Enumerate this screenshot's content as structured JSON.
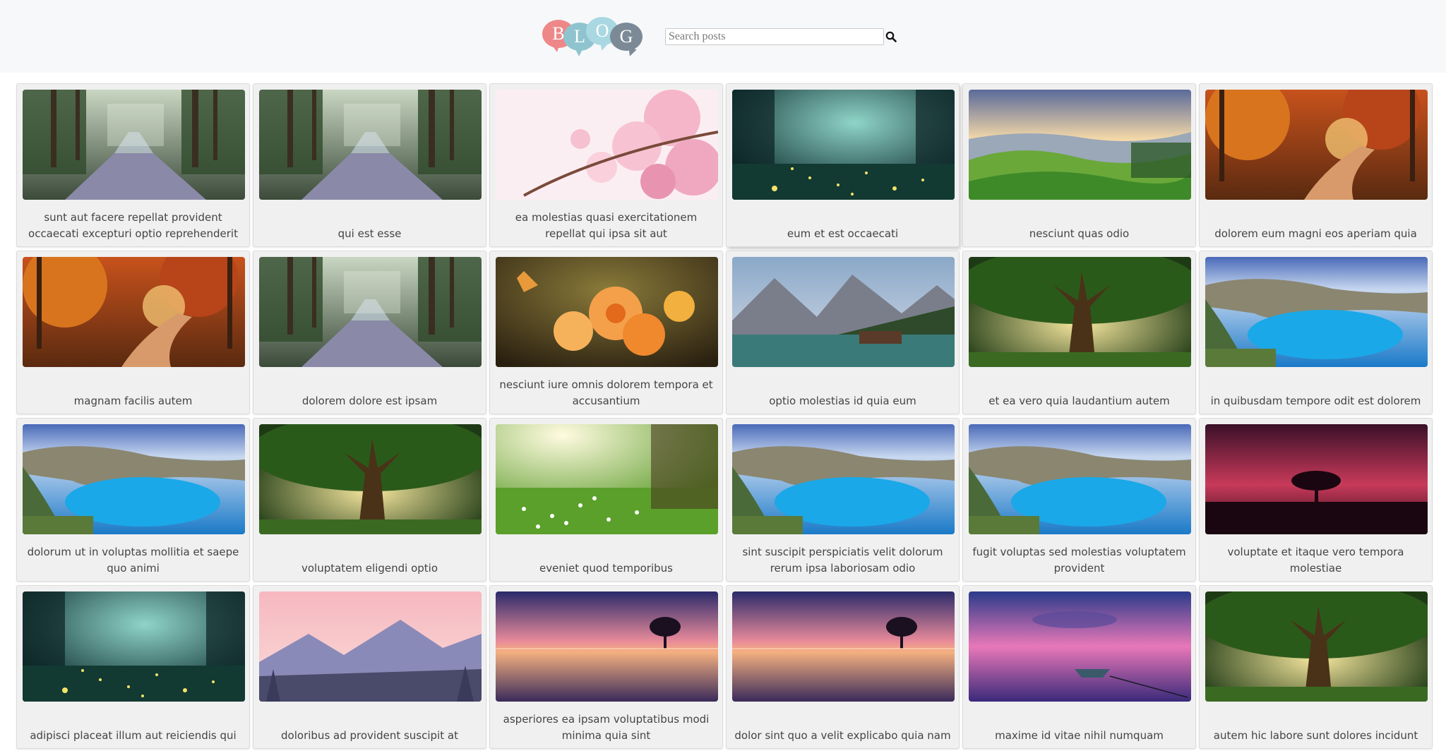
{
  "header": {
    "logo_letters": [
      "B",
      "L",
      "O",
      "G"
    ],
    "search": {
      "placeholder": "Search posts",
      "value": ""
    },
    "search_icon": "search-icon"
  },
  "posts": [
    {
      "title": "sunt aut facere repellat provident occaecati excepturi optio reprehenderit",
      "image": "forest-road"
    },
    {
      "title": "qui est esse",
      "image": "forest-road"
    },
    {
      "title": "ea molestias quasi exercitationem repellat qui ipsa sit aut",
      "image": "cherry-blossom"
    },
    {
      "title": "eum et est occaecati",
      "image": "firefly-forest"
    },
    {
      "title": "nesciunt quas odio",
      "image": "green-hills"
    },
    {
      "title": "dolorem eum magni eos aperiam quia",
      "image": "autumn-path"
    },
    {
      "title": "magnam facilis autem",
      "image": "autumn-path"
    },
    {
      "title": "dolorem dolore est ipsam",
      "image": "forest-road"
    },
    {
      "title": "nesciunt iure omnis dolorem tempora et accusantium",
      "image": "orange-flowers"
    },
    {
      "title": "optio molestias id quia eum",
      "image": "mountain-lake"
    },
    {
      "title": "et ea vero quia laudantium autem",
      "image": "big-tree"
    },
    {
      "title": "in quibusdam tempore odit est dolorem",
      "image": "coastal-bay"
    },
    {
      "title": "dolorum ut in voluptas mollitia et saepe quo animi",
      "image": "coastal-bay"
    },
    {
      "title": "voluptatem eligendi optio",
      "image": "big-tree"
    },
    {
      "title": "eveniet quod temporibus",
      "image": "meadow-flowers"
    },
    {
      "title": "sint suscipit perspiciatis velit dolorum rerum ipsa laboriosam odio",
      "image": "coastal-bay"
    },
    {
      "title": "fugit voluptas sed molestias voluptatem provident",
      "image": "coastal-bay"
    },
    {
      "title": "voluptate et itaque vero tempora molestiae",
      "image": "red-sky-tree"
    },
    {
      "title": "adipisci placeat illum aut reiciendis qui",
      "image": "firefly-forest"
    },
    {
      "title": "doloribus ad provident suscipit at",
      "image": "pink-mountains"
    },
    {
      "title": "asperiores ea ipsam voluptatibus modi minima quia sint",
      "image": "sunset-lake-tree"
    },
    {
      "title": "dolor sint quo a velit explicabo quia nam",
      "image": "sunset-lake-tree"
    },
    {
      "title": "maxime id vitae nihil numquam",
      "image": "boat-sunset"
    },
    {
      "title": "autem hic labore sunt dolores incidunt",
      "image": "big-tree"
    }
  ],
  "colors": {
    "header_bg": "#f7f8fa",
    "card_bg": "#f0f0f0",
    "logo_b": "#ee8888",
    "logo_l": "#8fc4cf",
    "logo_o": "#a9d8e2",
    "logo_g": "#7b8a96"
  }
}
